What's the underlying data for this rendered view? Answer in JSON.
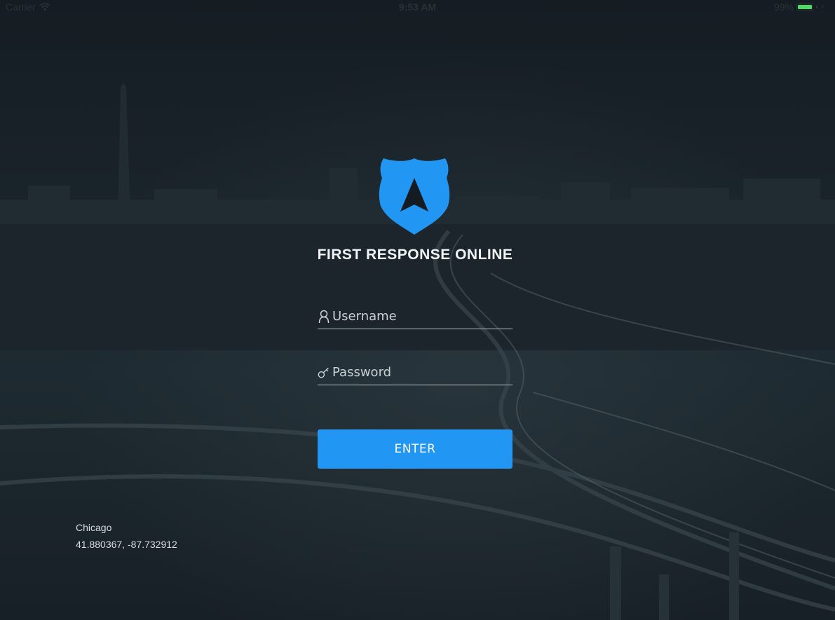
{
  "status_bar": {
    "carrier": "Carrier",
    "time": "9:53 AM",
    "battery": "99%",
    "battery_color": "#4cd964",
    "wifi_icon": "wifi-icon",
    "charging_icon": "bolt-icon"
  },
  "app": {
    "logo_icon": "shield-arrow-icon",
    "title": "FIRST RESPONSE ONLINE",
    "accent_color": "#2196f3"
  },
  "login": {
    "username_placeholder": "Username",
    "username_value": "",
    "username_icon": "user-icon",
    "password_placeholder": "Password",
    "password_value": "",
    "password_icon": "key-icon",
    "enter_label": "ENTER"
  },
  "location": {
    "city": "Chicago",
    "coordinates": "41.880367, -87.732912"
  }
}
